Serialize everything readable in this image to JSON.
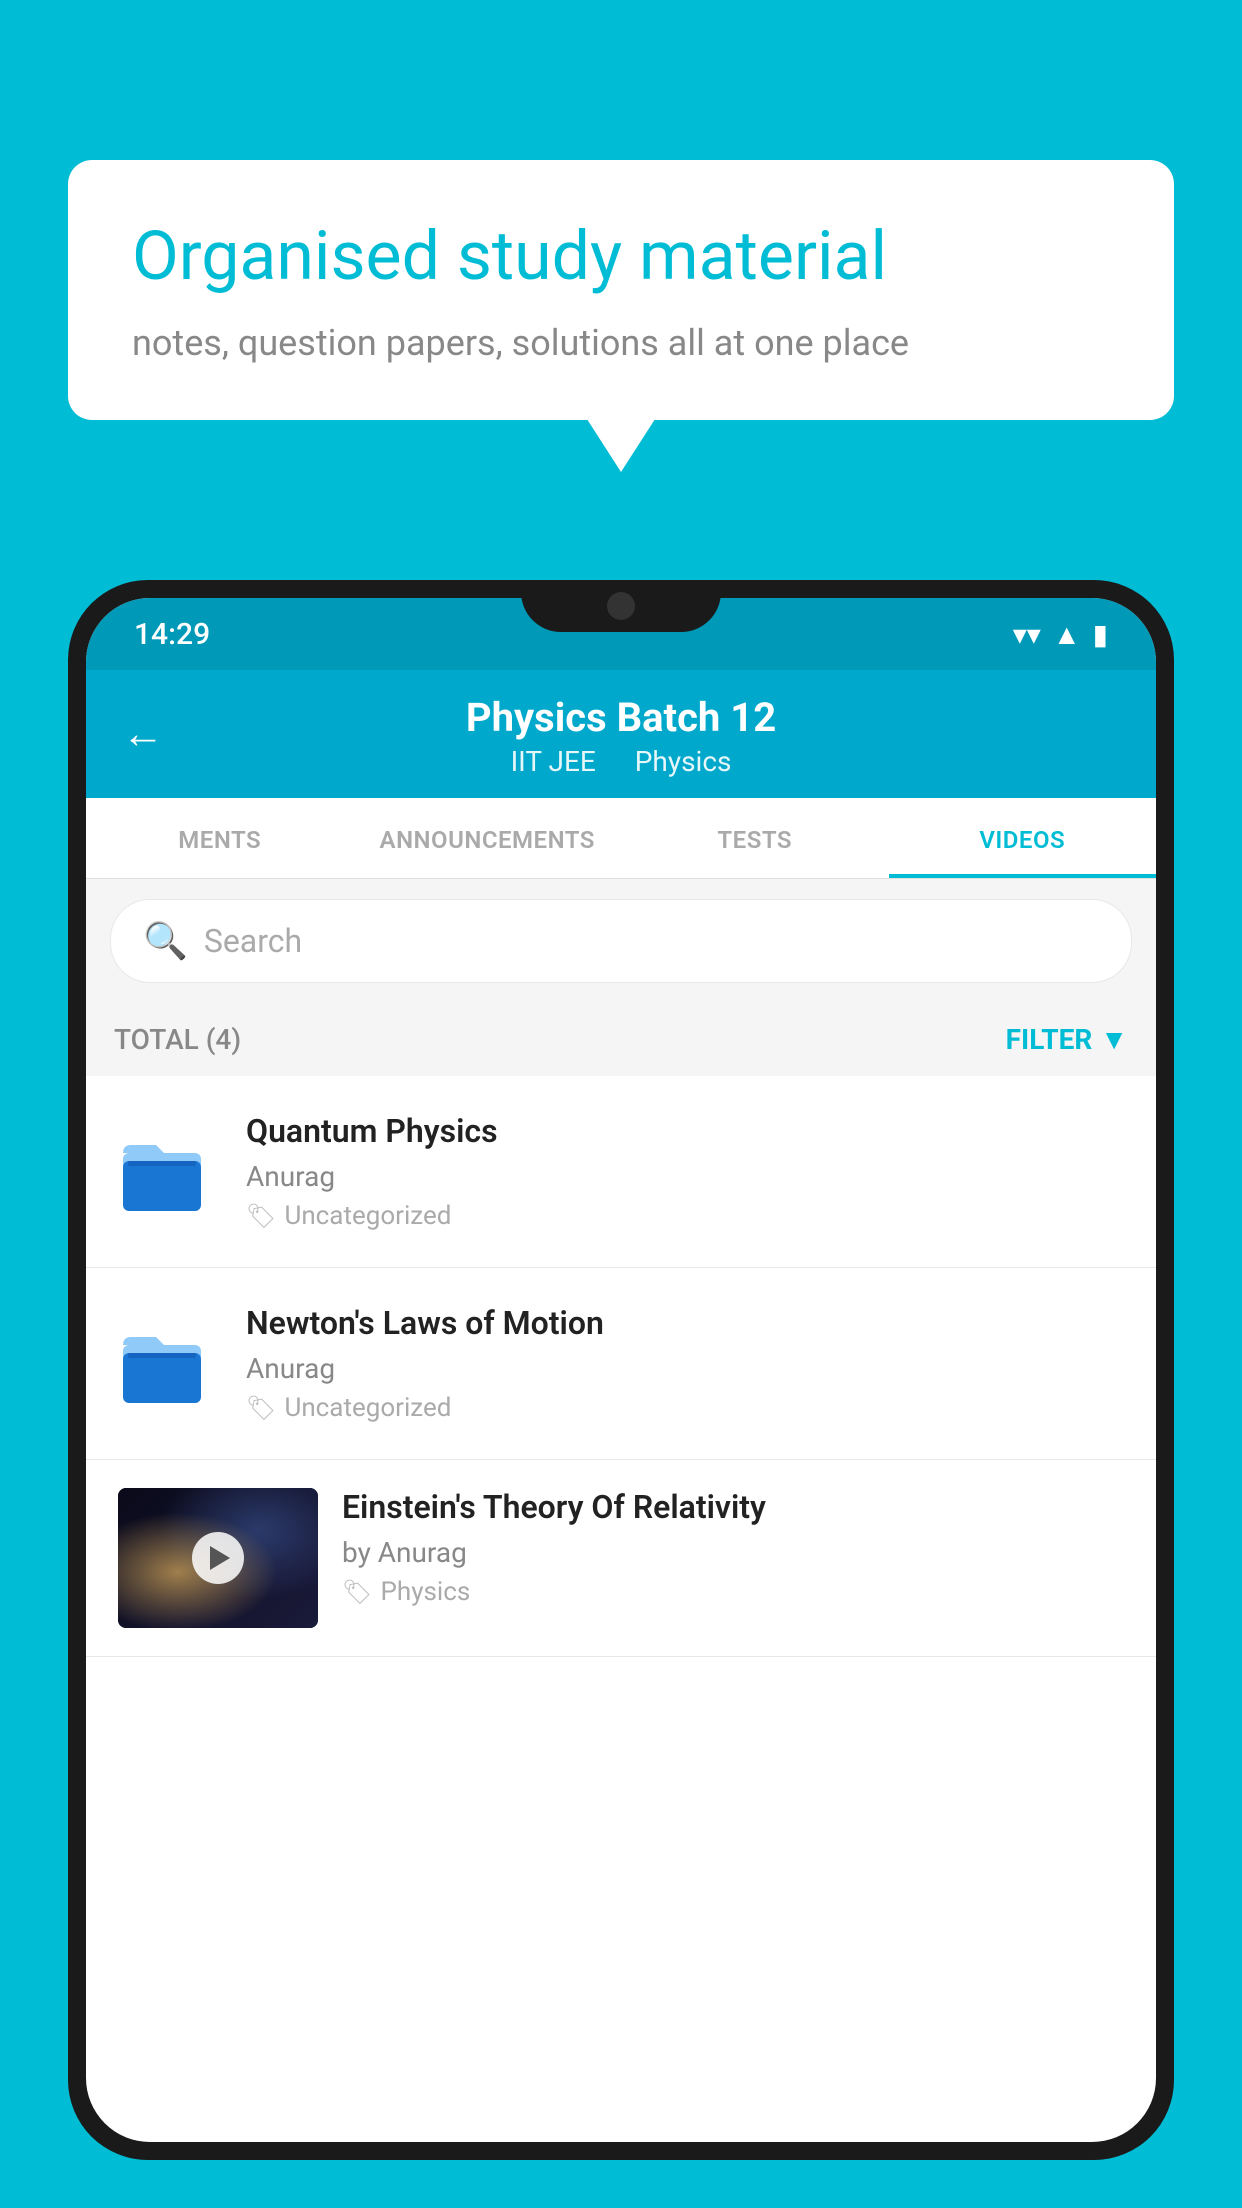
{
  "background": {
    "color": "#00BCD4"
  },
  "speech_bubble": {
    "title": "Organised study material",
    "subtitle": "notes, question papers, solutions all at one place"
  },
  "status_bar": {
    "time": "14:29",
    "wifi_icon": "▾",
    "signal_icon": "▲",
    "battery_icon": "▮"
  },
  "header": {
    "back_label": "←",
    "title": "Physics Batch 12",
    "subtitle_part1": "IIT JEE",
    "subtitle_part2": "Physics"
  },
  "tabs": [
    {
      "label": "MENTS",
      "active": false
    },
    {
      "label": "ANNOUNCEMENTS",
      "active": false
    },
    {
      "label": "TESTS",
      "active": false
    },
    {
      "label": "VIDEOS",
      "active": true
    }
  ],
  "search": {
    "placeholder": "Search"
  },
  "filter_bar": {
    "total_label": "TOTAL (4)",
    "filter_label": "FILTER"
  },
  "videos": [
    {
      "title": "Quantum Physics",
      "author": "Anurag",
      "tag": "Uncategorized",
      "has_thumbnail": false
    },
    {
      "title": "Newton's Laws of Motion",
      "author": "Anurag",
      "tag": "Uncategorized",
      "has_thumbnail": false
    },
    {
      "title": "Einstein's Theory Of Relativity",
      "author": "by Anurag",
      "tag": "Physics",
      "has_thumbnail": true
    }
  ]
}
